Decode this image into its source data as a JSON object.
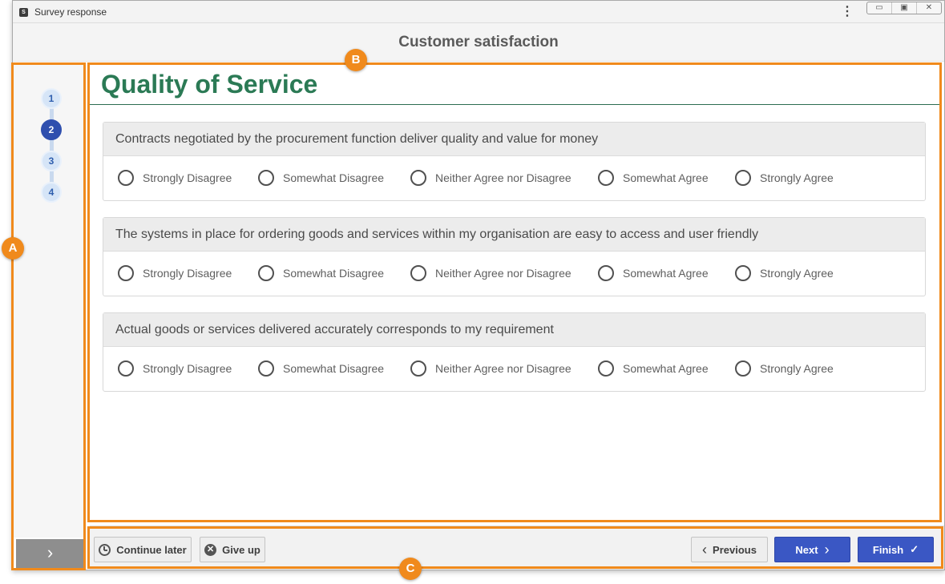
{
  "window": {
    "app_icon": "S",
    "title": "Survey response",
    "menu_icon": "kebab-menu-icon",
    "controls": [
      "minimize",
      "maximize",
      "close"
    ]
  },
  "header": {
    "title": "Customer satisfaction"
  },
  "steps": {
    "items": [
      "1",
      "2",
      "3",
      "4"
    ],
    "active_index": 1
  },
  "section": {
    "title": "Quality of Service"
  },
  "questions": [
    {
      "text": "Contracts negotiated by the procurement function deliver quality and value for money",
      "options": [
        "Strongly Disagree",
        "Somewhat Disagree",
        "Neither Agree nor Disagree",
        "Somewhat Agree",
        "Strongly Agree"
      ]
    },
    {
      "text": "The systems in place for ordering goods and services within my organisation are easy to access and user friendly",
      "options": [
        "Strongly Disagree",
        "Somewhat Disagree",
        "Neither Agree nor Disagree",
        "Somewhat Agree",
        "Strongly Agree"
      ]
    },
    {
      "text": "Actual goods or services delivered accurately corresponds to my requirement",
      "options": [
        "Strongly Disagree",
        "Somewhat Disagree",
        "Neither Agree nor Disagree",
        "Somewhat Agree",
        "Strongly Agree"
      ]
    }
  ],
  "footer": {
    "continue_later": "Continue later",
    "give_up": "Give up",
    "previous": "Previous",
    "next": "Next",
    "finish": "Finish"
  },
  "callouts": {
    "a": "A",
    "b": "B",
    "c": "C"
  },
  "colors": {
    "accent_callout": "#f08a1c",
    "section_title": "#2b7a55",
    "primary_button": "#3a57c4",
    "active_step": "#2f4fae"
  }
}
